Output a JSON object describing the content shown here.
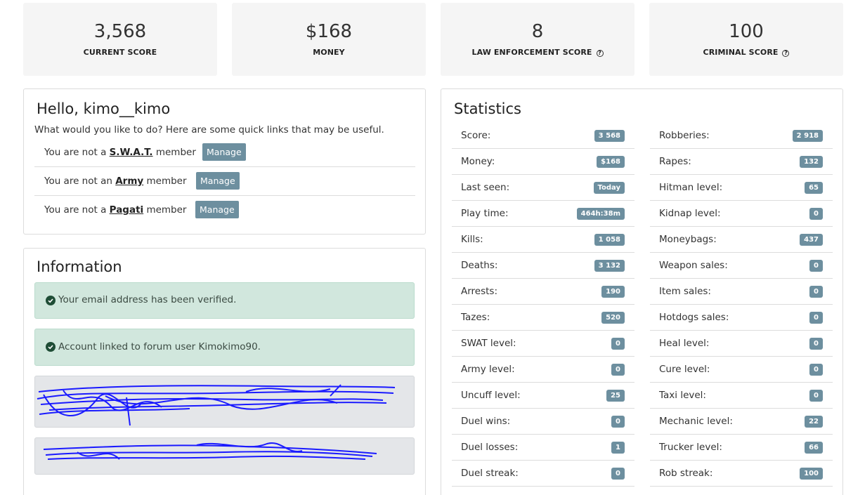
{
  "top_cards": [
    {
      "value": "3,568",
      "label": "CURRENT SCORE",
      "help": false
    },
    {
      "value": "$168",
      "label": "MONEY",
      "help": false
    },
    {
      "value": "8",
      "label": "LAW ENFORCEMENT SCORE",
      "help": true
    },
    {
      "value": "100",
      "label": "CRIMINAL SCORE",
      "help": true
    }
  ],
  "help_glyph": "?",
  "hello": {
    "title": "Hello, kimo__kimo",
    "subtitle": "What would you like to do? Here are some quick links that may be useful.",
    "rows": [
      {
        "prefix": "You are not a ",
        "group": "S.W.A.T.",
        "suffix": " member",
        "button": "Manage"
      },
      {
        "prefix": "You are not an ",
        "group": "Army",
        "suffix": " member",
        "button": "Manage"
      },
      {
        "prefix": "You are not a ",
        "group": "Pagati",
        "suffix": " member",
        "button": "Manage"
      }
    ]
  },
  "info": {
    "title": "Information",
    "alerts": [
      "Your email address has been verified.",
      "Account linked to forum user Kimokimo90."
    ]
  },
  "stats": {
    "title": "Statistics",
    "left": [
      {
        "label": "Score:",
        "value": "3 568"
      },
      {
        "label": "Money:",
        "value": "$168"
      },
      {
        "label": "Last seen:",
        "value": "Today"
      },
      {
        "label": "Play time:",
        "value": "464h:38m"
      },
      {
        "label": "Kills:",
        "value": "1 058"
      },
      {
        "label": "Deaths:",
        "value": "3 132"
      },
      {
        "label": "Arrests:",
        "value": "190"
      },
      {
        "label": "Tazes:",
        "value": "520"
      },
      {
        "label": "SWAT level:",
        "value": "0"
      },
      {
        "label": "Army level:",
        "value": "0"
      },
      {
        "label": "Uncuff level:",
        "value": "25"
      },
      {
        "label": "Duel wins:",
        "value": "0"
      },
      {
        "label": "Duel losses:",
        "value": "1"
      },
      {
        "label": "Duel streak:",
        "value": "0"
      }
    ],
    "right": [
      {
        "label": "Robberies:",
        "value": "2 918"
      },
      {
        "label": "Rapes:",
        "value": "132"
      },
      {
        "label": "Hitman level:",
        "value": "65"
      },
      {
        "label": "Kidnap level:",
        "value": "0"
      },
      {
        "label": "Moneybags:",
        "value": "437"
      },
      {
        "label": "Weapon sales:",
        "value": "0"
      },
      {
        "label": "Item sales:",
        "value": "0"
      },
      {
        "label": "Hotdogs sales:",
        "value": "0"
      },
      {
        "label": "Heal level:",
        "value": "0"
      },
      {
        "label": "Cure level:",
        "value": "0"
      },
      {
        "label": "Taxi level:",
        "value": "0"
      },
      {
        "label": "Mechanic level:",
        "value": "22"
      },
      {
        "label": "Trucker level:",
        "value": "66"
      },
      {
        "label": "Rob streak:",
        "value": "100"
      }
    ]
  },
  "colors": {
    "badge": "#6d8f9f",
    "alert_bg": "#d1e7dd",
    "scribble": "#1a1aff"
  }
}
